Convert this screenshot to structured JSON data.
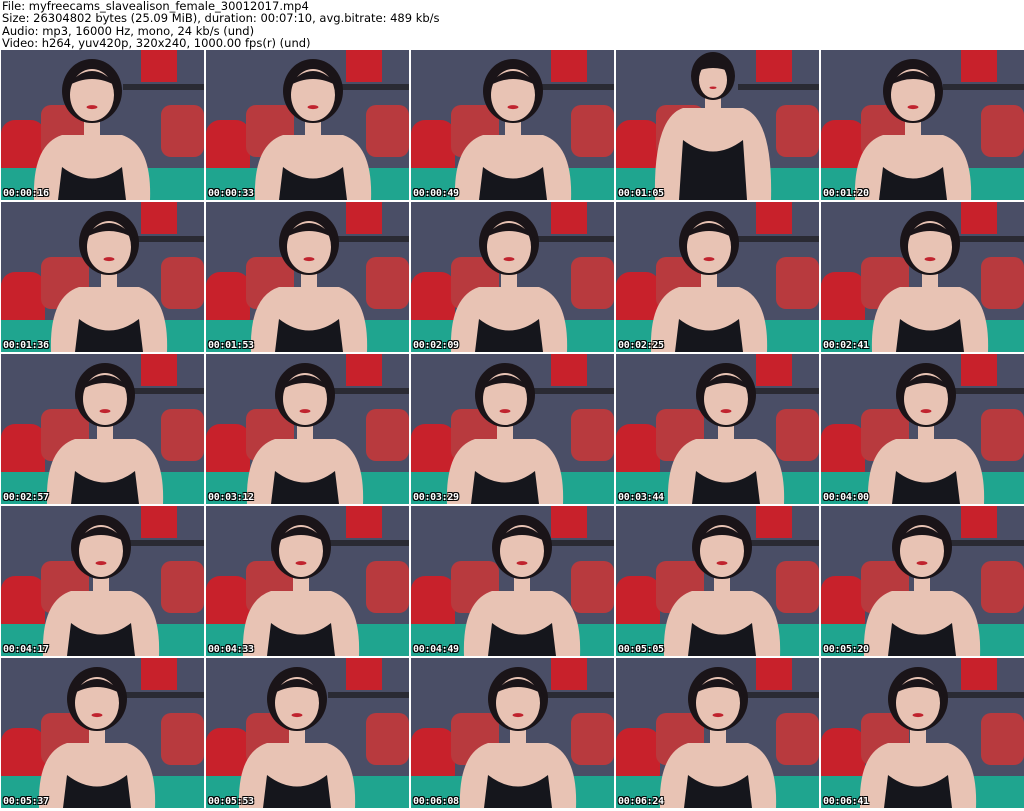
{
  "header": {
    "file_line": "File: myfreecams_slavealison_female_30012017.mp4",
    "size_line": "Size: 26304802 bytes (25.09 MiB), duration: 00:07:10, avg.bitrate: 489 kb/s",
    "audio_line": "Audio: mp3, 16000 Hz, mono, 24 kb/s (und)",
    "video_line": "Video: h264, yuv420p, 320x240, 1000.00 fps(r) (und)"
  },
  "thumbnails": [
    {
      "timestamp": "00:00:16"
    },
    {
      "timestamp": "00:00:33"
    },
    {
      "timestamp": "00:00:49"
    },
    {
      "timestamp": "00:01:05"
    },
    {
      "timestamp": "00:01:20"
    },
    {
      "timestamp": "00:01:36"
    },
    {
      "timestamp": "00:01:53"
    },
    {
      "timestamp": "00:02:09"
    },
    {
      "timestamp": "00:02:25"
    },
    {
      "timestamp": "00:02:41"
    },
    {
      "timestamp": "00:02:57"
    },
    {
      "timestamp": "00:03:12"
    },
    {
      "timestamp": "00:03:29"
    },
    {
      "timestamp": "00:03:44"
    },
    {
      "timestamp": "00:04:00"
    },
    {
      "timestamp": "00:04:17"
    },
    {
      "timestamp": "00:04:33"
    },
    {
      "timestamp": "00:04:49"
    },
    {
      "timestamp": "00:05:05"
    },
    {
      "timestamp": "00:05:20"
    },
    {
      "timestamp": "00:05:37"
    },
    {
      "timestamp": "00:05:53"
    },
    {
      "timestamp": "00:06:08"
    },
    {
      "timestamp": "00:06:24"
    },
    {
      "timestamp": "00:06:41"
    }
  ],
  "colors": {
    "wall": "#4a4e66",
    "pillow_red": "#c8212b",
    "sheet_teal": "#1fa58f",
    "skin": "#e8c3b4",
    "hair": "#1a1418",
    "top": "#15161c",
    "timestamp_text": "#ffffff"
  }
}
